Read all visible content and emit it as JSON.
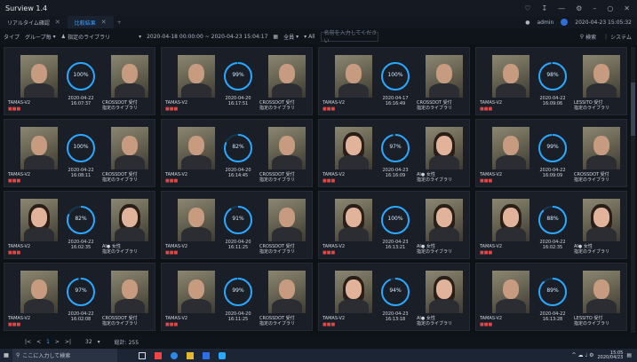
{
  "app": {
    "title": "Surview 1.4"
  },
  "window_icons": [
    "bell-icon",
    "download-icon",
    "minimize-line-icon",
    "settings-icon",
    "minimize-icon",
    "restore-icon",
    "close-icon"
  ],
  "tabs": [
    {
      "label": "リアルタイム確認"
    },
    {
      "label": "比較結果"
    }
  ],
  "user": {
    "name": "admin",
    "datetime": "2020-04-23 15:05:32"
  },
  "toolbar": {
    "type_label": "タイプ",
    "group_label": "グループ毎",
    "library_label": "指定のライブラリ",
    "range": "2020-04-18 00:00:00 ~ 2020-04-23 15:04:17",
    "all1": "全員",
    "all2": "All",
    "search_placeholder": "名前を入力してください",
    "search_btn": "検索",
    "system_label": "システム"
  },
  "colors": {
    "accent": "#3aa0ff",
    "ring": "#2aa7ff",
    "alert": "#e04848"
  },
  "cards": [
    {
      "pct": "100%",
      "date": "2020-04-22",
      "time": "16:07:37",
      "cam": "TAMAS-V2",
      "red": "■■■",
      "rname1": "CROSSDOT 受付",
      "rname2": "指定のライブラリ",
      "lf": 0,
      "rf": 0
    },
    {
      "pct": "99%",
      "date": "2020-04-20",
      "time": "16:17:51",
      "cam": "TAMAS-V2",
      "red": "■■■",
      "rname1": "CROSSDOT 受付",
      "rname2": "指定のライブラリ",
      "lf": 0,
      "rf": 0
    },
    {
      "pct": "100%",
      "date": "2020-04-17",
      "time": "16:16:49",
      "cam": "TAMAS-V2",
      "red": "■■■",
      "rname1": "CROSSDOT 受付",
      "rname2": "指定のライブラリ",
      "lf": 0,
      "rf": 0
    },
    {
      "pct": "98%",
      "date": "2020-04-22",
      "time": "16:09:06",
      "cam": "TAMAS-V2",
      "red": "■■■",
      "rname1": "LESSITO 受付",
      "rname2": "指定のライブラリ",
      "lf": 0,
      "rf": 0
    },
    {
      "pct": "100%",
      "date": "2020-04-22",
      "time": "16:08:11",
      "cam": "TAMAS-V2",
      "red": "■■■",
      "rname1": "CROSSDOT 受付",
      "rname2": "指定のライブラリ",
      "lf": 0,
      "rf": 0
    },
    {
      "pct": "82%",
      "date": "2020-04-20",
      "time": "16:14:45",
      "cam": "TAMAS-V2",
      "red": "■■■",
      "rname1": "CROSSDOT 受付",
      "rname2": "指定のライブラリ",
      "lf": 0,
      "rf": 0
    },
    {
      "pct": "97%",
      "date": "2020-04-23",
      "time": "16:16:09",
      "cam": "TAMAS-V2",
      "red": "■■■",
      "rname1": "AI● 女性",
      "rname2": "指定のライブラリ",
      "lf": 1,
      "rf": 1
    },
    {
      "pct": "99%",
      "date": "2020-04-22",
      "time": "16:09:09",
      "cam": "TAMAS-V2",
      "red": "■■■",
      "rname1": "CROSSDOT 受付",
      "rname2": "指定のライブラリ",
      "lf": 0,
      "rf": 0
    },
    {
      "pct": "82%",
      "date": "2020-04-22",
      "time": "16:02:35",
      "cam": "TAMAS-V2",
      "red": "■■■",
      "rname1": "AI● 女性",
      "rname2": "指定のライブラリ",
      "lf": 1,
      "rf": 1
    },
    {
      "pct": "91%",
      "date": "2020-04-20",
      "time": "16:11:25",
      "cam": "TAMAS-V2",
      "red": "■■■",
      "rname1": "CROSSDOT 受付",
      "rname2": "指定のライブラリ",
      "lf": 0,
      "rf": 0
    },
    {
      "pct": "100%",
      "date": "2020-04-23",
      "time": "16:13:21",
      "cam": "TAMAS-V2",
      "red": "■■■",
      "rname1": "AI● 女性",
      "rname2": "指定のライブラリ",
      "lf": 1,
      "rf": 1
    },
    {
      "pct": "88%",
      "date": "2020-04-22",
      "time": "16:02:35",
      "cam": "TAMAS-V2",
      "red": "■■■",
      "rname1": "AI● 女性",
      "rname2": "指定のライブラリ",
      "lf": 1,
      "rf": 1
    },
    {
      "pct": "97%",
      "date": "2020-04-22",
      "time": "16:02:08",
      "cam": "TAMAS-V2",
      "red": "■■■",
      "rname1": "CROSSDOT 受付",
      "rname2": "指定のライブラリ",
      "lf": 0,
      "rf": 0
    },
    {
      "pct": "99%",
      "date": "2020-04-20",
      "time": "16:11:25",
      "cam": "TAMAS-V2",
      "red": "■■■",
      "rname1": "CROSSDOT 受付",
      "rname2": "指定のライブラリ",
      "lf": 0,
      "rf": 0
    },
    {
      "pct": "94%",
      "date": "2020-04-23",
      "time": "16:13:18",
      "cam": "TAMAS-V2",
      "red": "■■■",
      "rname1": "AI● 女性",
      "rname2": "指定のライブラリ",
      "lf": 1,
      "rf": 1
    },
    {
      "pct": "89%",
      "date": "2020-04-22",
      "time": "16:13:28",
      "cam": "TAMAS-V2",
      "red": "■■■",
      "rname1": "LESSITO 受付",
      "rname2": "指定のライブラリ",
      "lf": 0,
      "rf": 0
    }
  ],
  "pager": {
    "first": "|<",
    "prev": "<",
    "page": "1",
    "next": ">",
    "last": ">|",
    "per_page": "32",
    "total": "総計: 255"
  },
  "taskbar": {
    "search": "ここに入力して検索",
    "time": "15:05",
    "date": "2020/04/23"
  }
}
